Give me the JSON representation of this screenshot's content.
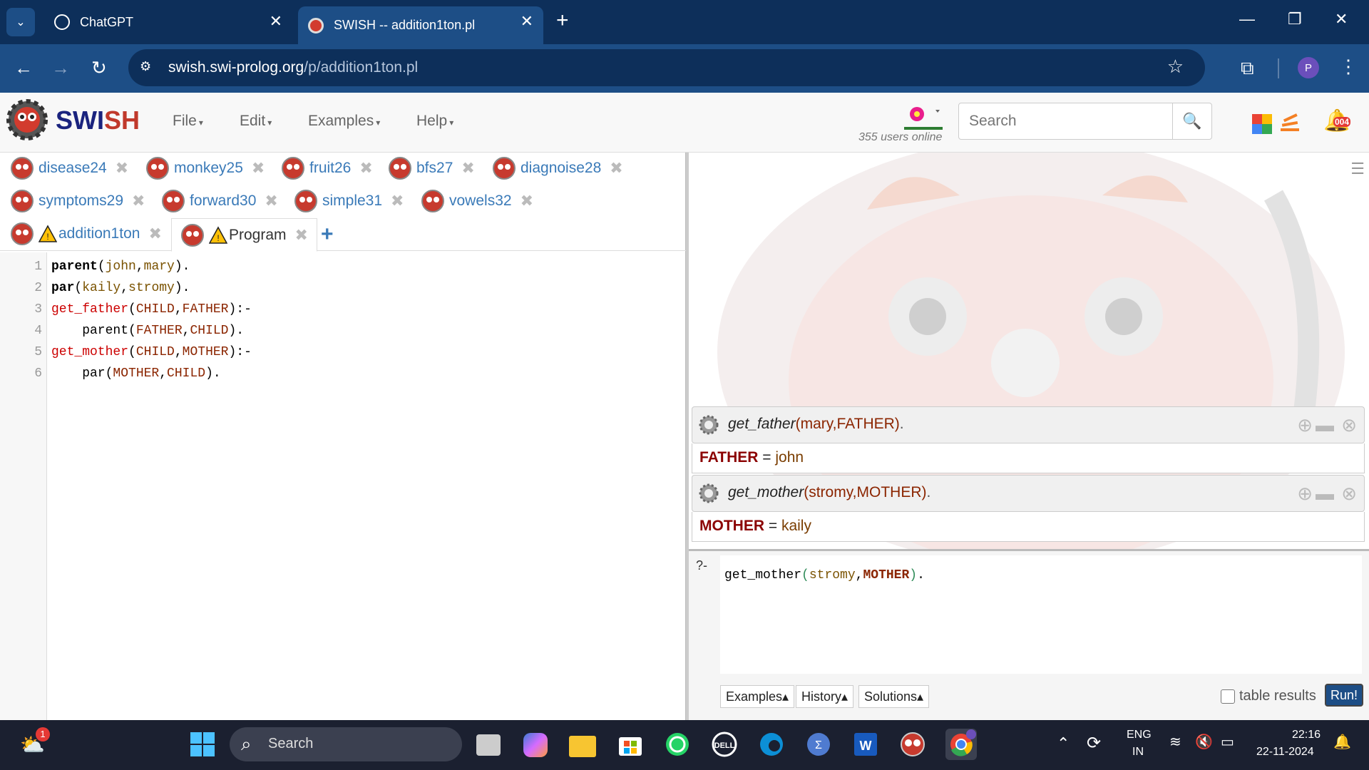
{
  "browser": {
    "tabs": [
      {
        "title": "ChatGPT",
        "active": false
      },
      {
        "title": "SWISH -- addition1ton.pl",
        "active": true
      }
    ],
    "url_host": "swish.swi-prolog.org",
    "url_path": "/p/addition1ton.pl",
    "profile_initial": "P"
  },
  "swish": {
    "logo": "SWISH",
    "menus": [
      "File",
      "Edit",
      "Examples",
      "Help"
    ],
    "users_online": "355 users online",
    "search_placeholder": "Search",
    "notification_count": "004"
  },
  "file_tabs": {
    "row1": [
      "disease24",
      "monkey25",
      "fruit26",
      "bfs27",
      "diagnoise28"
    ],
    "row2": [
      "symptoms29",
      "forward30",
      "simple31",
      "vowels32"
    ],
    "row3": [
      "addition1ton",
      "Program"
    ]
  },
  "editor": {
    "line_numbers": [
      "1",
      "2",
      "3",
      "4",
      "5",
      "6"
    ]
  },
  "queries": [
    {
      "pred": "get_father",
      "args": "(mary,FATHER)",
      "end": ".",
      "var": "FATHER",
      "eq": " = ",
      "value": "john"
    },
    {
      "pred": "get_mother",
      "args": "(stromy,MOTHER)",
      "end": ".",
      "var": "MOTHER",
      "eq": " = ",
      "value": "kaily"
    }
  ],
  "query_box": {
    "prompt": "?-",
    "buttons": [
      "Examples▴",
      "History▴",
      "Solutions▴"
    ],
    "table_results_label": "table results",
    "run_label": "Run!"
  },
  "taskbar": {
    "search_label": "Search",
    "badge": "1",
    "lang_line1": "ENG",
    "lang_line2": "IN",
    "time": "22:16",
    "date": "22-11-2024"
  },
  "colors": {
    "chrome_dark": "#0d2f5a",
    "chrome_mid": "#1d4e86",
    "swish_blue": "#1a237e",
    "prolog_head": "#cc0000",
    "prolog_var": "#8b2500"
  }
}
